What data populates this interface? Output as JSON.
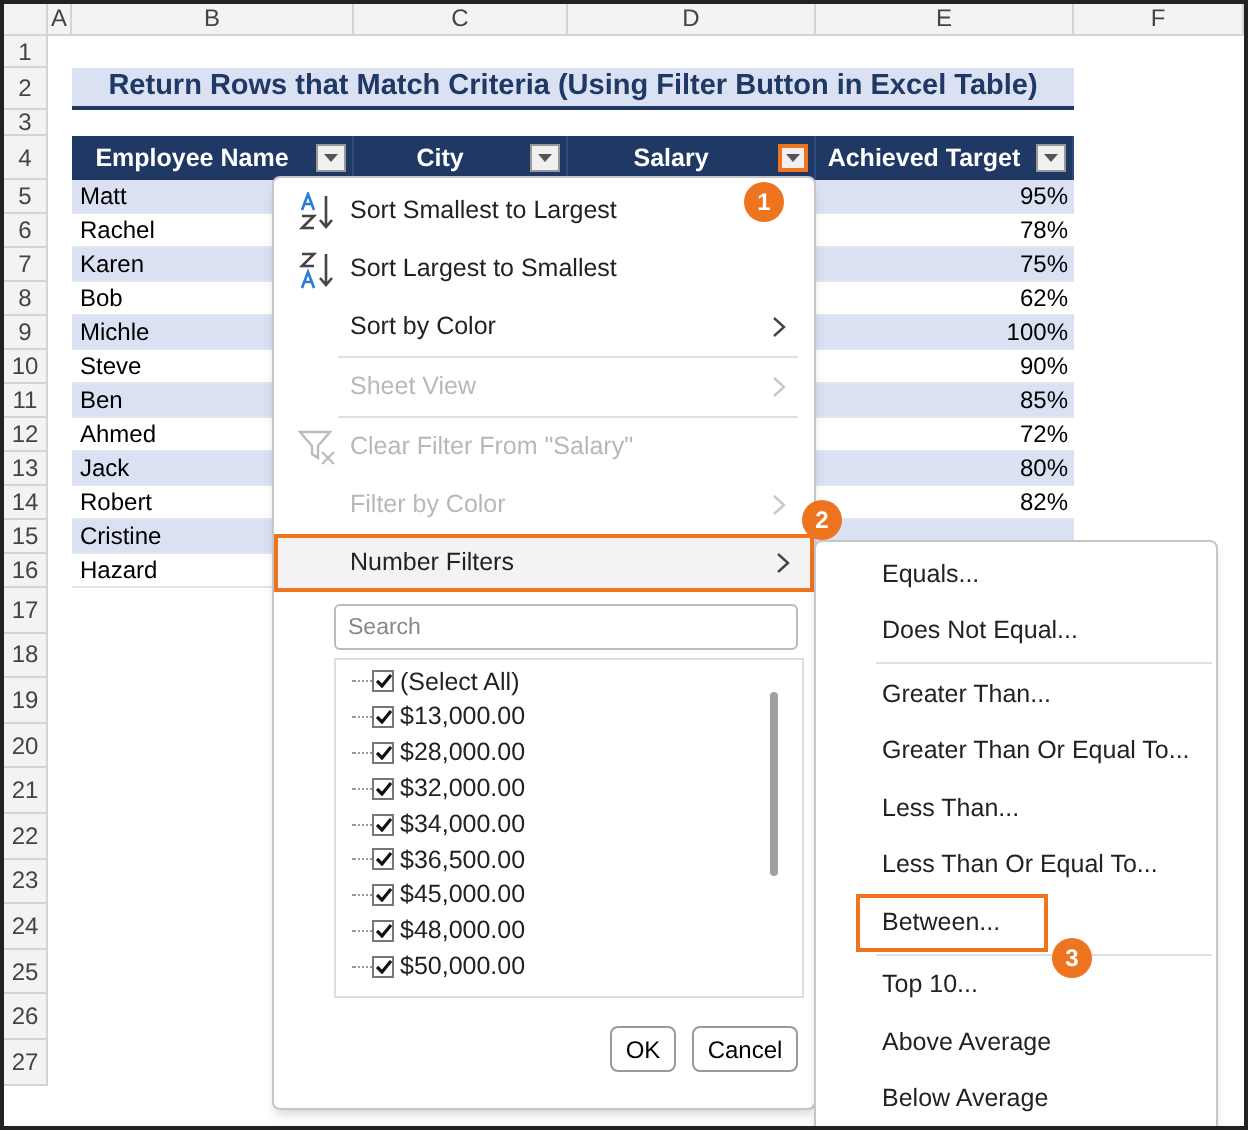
{
  "sheet": {
    "columns": [
      "A",
      "B",
      "C",
      "D",
      "E",
      "F"
    ],
    "row_numbers": [
      "1",
      "2",
      "3",
      "4",
      "5",
      "6",
      "7",
      "8",
      "9",
      "10",
      "11",
      "12",
      "13",
      "14",
      "15",
      "16",
      "17",
      "18",
      "19",
      "20",
      "21",
      "22",
      "23",
      "24",
      "25",
      "26",
      "27"
    ],
    "title": "Return Rows that Match Criteria (Using Filter Button in Excel Table)",
    "headers": [
      {
        "label": "Employee Name",
        "filter_highlighted": false
      },
      {
        "label": "City",
        "filter_highlighted": false
      },
      {
        "label": "Salary",
        "filter_highlighted": true,
        "callout": "1"
      },
      {
        "label": "Achieved Target",
        "filter_highlighted": false
      }
    ],
    "rows": [
      {
        "name": "Matt",
        "target": "95%"
      },
      {
        "name": "Rachel",
        "target": "78%"
      },
      {
        "name": "Karen",
        "target": "75%"
      },
      {
        "name": "Bob",
        "target": "62%"
      },
      {
        "name": "Michle",
        "target": "100%"
      },
      {
        "name": "Steve",
        "target": "90%"
      },
      {
        "name": "Ben",
        "target": "85%"
      },
      {
        "name": "Ahmed",
        "target": "72%"
      },
      {
        "name": "Jack",
        "target": "80%"
      },
      {
        "name": "Robert",
        "target": "82%"
      },
      {
        "name": "Cristine"
      },
      {
        "name": "Hazard"
      }
    ]
  },
  "filter_menu": {
    "items": [
      {
        "kind": "sort_ascending",
        "label": "Sort Smallest to Largest",
        "disabled": false,
        "highlighted": false
      },
      {
        "kind": "sort_descending",
        "label": "Sort Largest to Smallest",
        "disabled": false,
        "highlighted": false
      },
      {
        "kind": "submenu",
        "label": "Sort by Color",
        "disabled": false,
        "highlighted": false
      },
      {
        "kind": "separator"
      },
      {
        "kind": "submenu",
        "label": "Sheet View",
        "disabled": true,
        "highlighted": false
      },
      {
        "kind": "separator"
      },
      {
        "kind": "clear_filter",
        "label": "Clear Filter From \"Salary\"",
        "disabled": true,
        "highlighted": false
      },
      {
        "kind": "submenu",
        "label": "Filter by Color",
        "disabled": true,
        "highlighted": false
      },
      {
        "kind": "submenu",
        "label": "Number Filters",
        "disabled": false,
        "highlighted": true,
        "callout": "2"
      }
    ],
    "search": {
      "placeholder": "Search"
    },
    "values": [
      {
        "label": "(Select All)",
        "checked": true
      },
      {
        "label": "$13,000.00",
        "checked": true
      },
      {
        "label": "$28,000.00",
        "checked": true
      },
      {
        "label": "$32,000.00",
        "checked": true
      },
      {
        "label": "$34,000.00",
        "checked": true
      },
      {
        "label": "$36,500.00",
        "checked": true
      },
      {
        "label": "$45,000.00",
        "checked": true
      },
      {
        "label": "$48,000.00",
        "checked": true
      },
      {
        "label": "$50,000.00",
        "checked": true
      }
    ],
    "buttons": [
      "OK",
      "Cancel"
    ]
  },
  "number_filters_menu": {
    "items": [
      {
        "kind": "item",
        "label": "Equals...",
        "highlighted": false
      },
      {
        "kind": "item",
        "label": "Does Not Equal...",
        "highlighted": false
      },
      {
        "kind": "separator"
      },
      {
        "kind": "item",
        "label": "Greater Than...",
        "highlighted": false
      },
      {
        "kind": "item",
        "label": "Greater Than Or Equal To...",
        "highlighted": false
      },
      {
        "kind": "item",
        "label": "Less Than...",
        "highlighted": false
      },
      {
        "kind": "item",
        "label": "Less Than Or Equal To...",
        "highlighted": false
      },
      {
        "kind": "item",
        "label": "Between...",
        "highlighted": true,
        "callout": "3"
      },
      {
        "kind": "separator"
      },
      {
        "kind": "item",
        "label": "Top 10...",
        "highlighted": false
      },
      {
        "kind": "item",
        "label": "Above Average",
        "highlighted": false
      },
      {
        "kind": "item",
        "label": "Below Average",
        "highlighted": false
      }
    ]
  }
}
